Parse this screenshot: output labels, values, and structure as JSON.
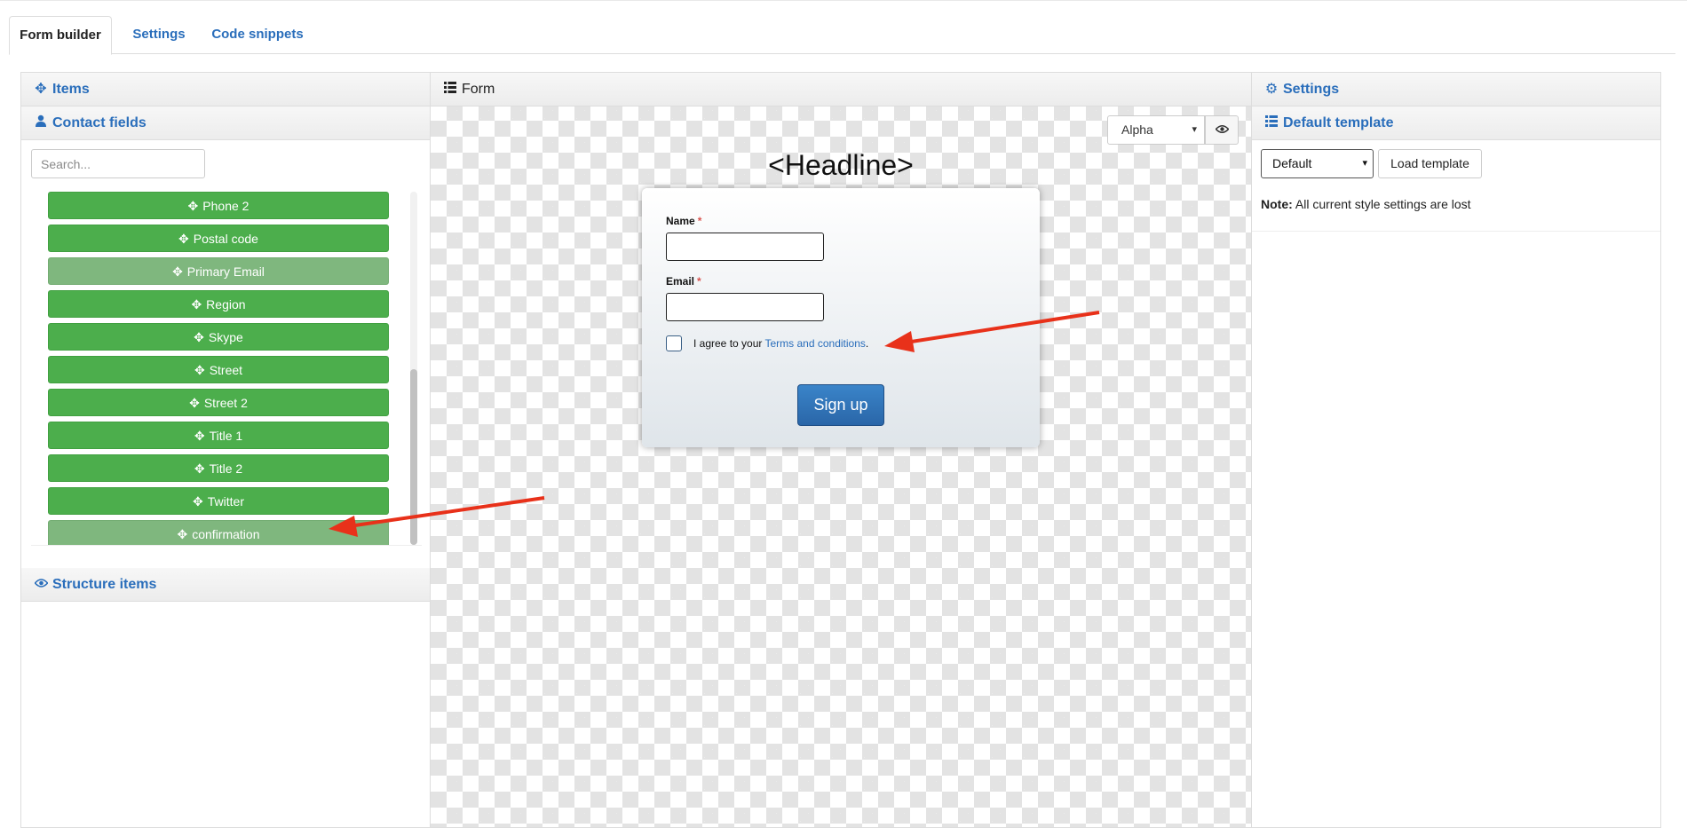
{
  "tabs": [
    {
      "label": "Form builder"
    },
    {
      "label": "Settings"
    },
    {
      "label": "Code snippets"
    }
  ],
  "left": {
    "items_title": "Items",
    "contact_title": "Contact fields",
    "search_placeholder": "Search...",
    "fields": [
      {
        "label": "Phone 2",
        "used": false
      },
      {
        "label": "Postal code",
        "used": false
      },
      {
        "label": "Primary Email",
        "used": true
      },
      {
        "label": "Region",
        "used": false
      },
      {
        "label": "Skype",
        "used": false
      },
      {
        "label": "Street",
        "used": false
      },
      {
        "label": "Street 2",
        "used": false
      },
      {
        "label": "Title 1",
        "used": false
      },
      {
        "label": "Title 2",
        "used": false
      },
      {
        "label": "Twitter",
        "used": false
      },
      {
        "label": "confirmation",
        "used": true
      }
    ],
    "structure_title": "Structure items"
  },
  "center": {
    "title": "Form",
    "alpha_value": "Alpha",
    "headline": "<Headline>",
    "name_label": "Name",
    "email_label": "Email",
    "required_mark": "*",
    "agree_text": "I agree to your ",
    "terms_link": "Terms and conditions",
    "agree_end": ".",
    "signup_label": "Sign up"
  },
  "right": {
    "settings_title": "Settings",
    "template_title": "Default template",
    "template_value": "Default",
    "load_label": "Load template",
    "note_bold": "Note:",
    "note_text": " All current style settings are lost"
  },
  "colors": {
    "field_green": "#4cae4c",
    "field_used": "#7fb77e",
    "link_blue": "#2a6ebb",
    "arrow_red": "#e8311a"
  }
}
